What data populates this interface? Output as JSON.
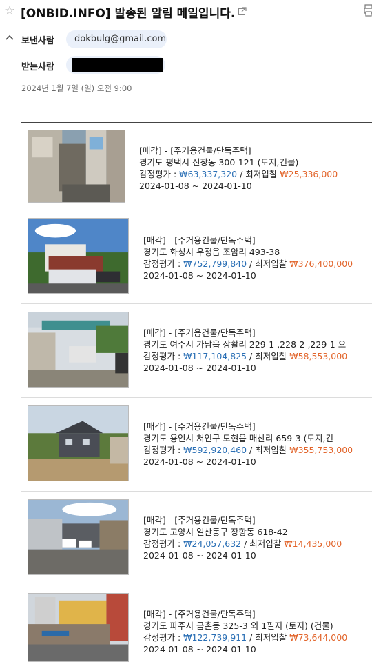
{
  "email": {
    "subject": "[ONBID.INFO] 발송된 알림 메일입니다.",
    "from_label": "보낸사람",
    "from_address": "dokbulg@gmail.com",
    "to_label": "받는사람",
    "date": "2024년 1월 7일 (일) 오전 9:00"
  },
  "listings": [
    {
      "category": "[매각] - [주거용건물/단독주택]",
      "address": "경기도 평택시 신장동 300-121 (토지,건물)",
      "appraisal_label": "감정평가 : ",
      "appraisal_value": "₩63,337,320",
      "separator": " / ",
      "min_bid_label": "최저입찰 ",
      "min_bid_value": "₩25,336,000",
      "period": "2024-01-08 ~ 2024-01-10"
    },
    {
      "category": "[매각] - [주거용건물/단독주택]",
      "address": "경기도 화성시 우정읍 조암리 493-38",
      "appraisal_label": "감정평가 : ",
      "appraisal_value": "₩752,799,840",
      "separator": " / ",
      "min_bid_label": "최저입찰 ",
      "min_bid_value": "₩376,400,000",
      "period": "2024-01-08 ~ 2024-01-10"
    },
    {
      "category": "[매각] - [주거용건물/단독주택]",
      "address": "경기도 여주시 가남읍 상활리 229-1 ,228-2 ,229-1 오",
      "appraisal_label": "감정평가 : ",
      "appraisal_value": "₩117,104,825",
      "separator": " / ",
      "min_bid_label": "최저입찰 ",
      "min_bid_value": "₩58,553,000",
      "period": "2024-01-08 ~ 2024-01-10"
    },
    {
      "category": "[매각] - [주거용건물/단독주택]",
      "address": "경기도 용인시 처인구 모현읍 매산리 659-3 (토지,건",
      "appraisal_label": "감정평가 : ",
      "appraisal_value": "₩592,920,460",
      "separator": " / ",
      "min_bid_label": "최저입찰 ",
      "min_bid_value": "₩355,753,000",
      "period": "2024-01-08 ~ 2024-01-10"
    },
    {
      "category": "[매각] - [주거용건물/단독주택]",
      "address": "경기도 고양시 일산동구 장항동 618-42",
      "appraisal_label": "감정평가 : ",
      "appraisal_value": "₩24,057,632",
      "separator": " / ",
      "min_bid_label": "최저입찰 ",
      "min_bid_value": "₩14,435,000",
      "period": "2024-01-08 ~ 2024-01-10"
    },
    {
      "category": "[매각] - [주거용건물/단독주택]",
      "address": "경기도 파주시 금촌동 325-3 외 1필지 (토지) (건물)",
      "appraisal_label": "감정평가 : ",
      "appraisal_value": "₩122,739,911",
      "separator": " / ",
      "min_bid_label": "최저입찰 ",
      "min_bid_value": "₩73,644,000",
      "period": "2024-01-08 ~ 2024-01-10"
    }
  ],
  "icons": {
    "star": "star-outline-icon",
    "popout": "open-in-new-window-icon",
    "print": "print-icon",
    "collapse": "chevron-up-icon"
  },
  "colors": {
    "appraisal": "#2a6fb5",
    "min_bid": "#e2642a",
    "chip": "#eaf0fa"
  }
}
